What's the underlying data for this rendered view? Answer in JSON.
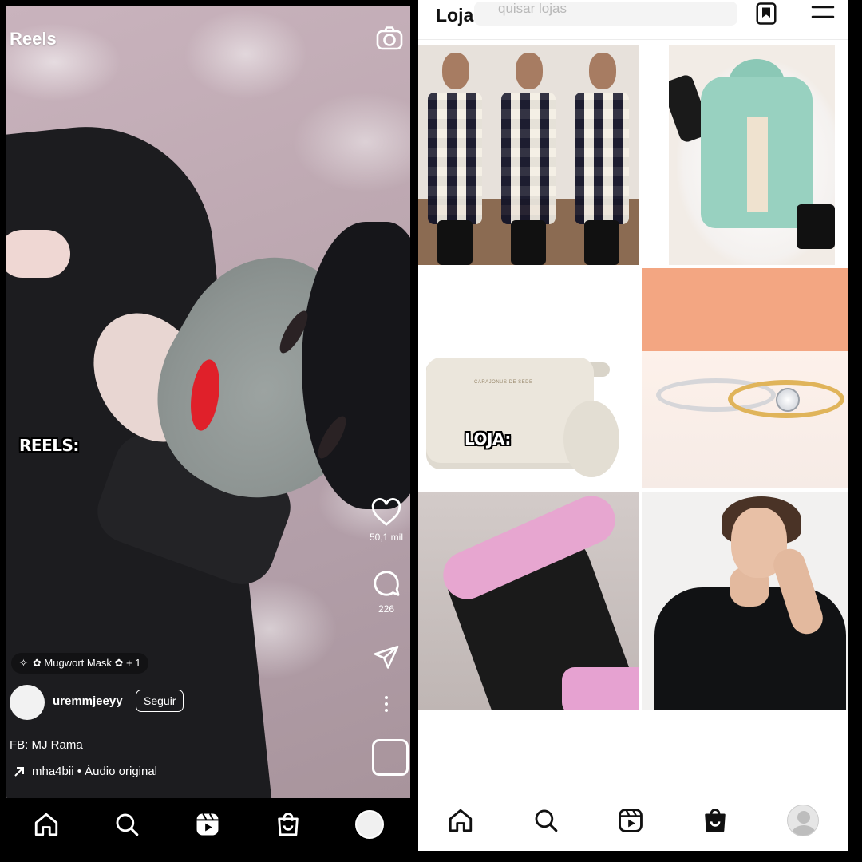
{
  "reels_screen": {
    "title": "Reels",
    "overlay_label": "REELS:",
    "like_count": "50,1 mil",
    "comment_count": "226",
    "effect": "✿ Mugwort Mask ✿ + 1",
    "username": "uremmjeeyy",
    "follow_label": "Seguir",
    "caption": "FB: MJ Rama",
    "audio": "mha4bii • Áudio original",
    "nav": [
      "home-icon",
      "search-icon",
      "reels-icon",
      "shop-icon",
      "profile-avatar"
    ]
  },
  "shop_screen": {
    "title": "Loja",
    "search_placeholder": "quisar lojas",
    "overlay_label": "LOJA:",
    "bag_brand": "CARAJONUS DE SEDE",
    "tiles": [
      "plaid-coat",
      "mint-jacket",
      "cream-bag",
      "rings",
      "pink-sole-boot",
      "model-black-top"
    ],
    "nav": [
      "home-icon",
      "search-icon",
      "reels-icon",
      "shop-icon",
      "profile-avatar"
    ]
  },
  "colors": {
    "reels_background": "#000000",
    "shop_background": "#ffffff",
    "accent_lips": "#e0202a",
    "rings_wall": "#f3a682",
    "boot_sole": "#e7a6d0"
  }
}
